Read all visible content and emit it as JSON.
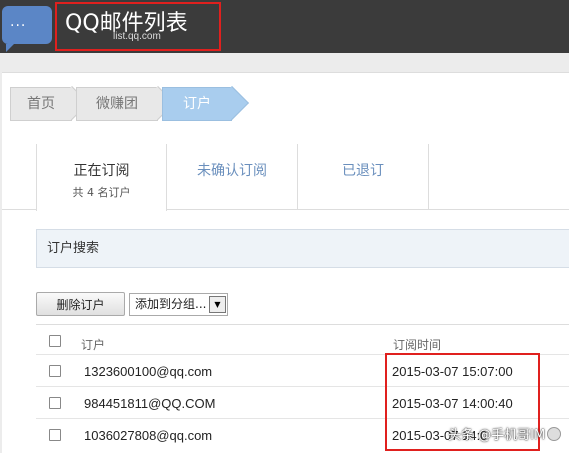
{
  "header": {
    "app_title": "QQ邮件列表",
    "subtitle": "list.qq.com",
    "logo_glyph": "···"
  },
  "breadcrumb": [
    {
      "label": "首页"
    },
    {
      "label": "微赚团"
    },
    {
      "label": "订户"
    }
  ],
  "tabs": [
    {
      "label": "正在订阅",
      "sub": "共 4 名订户",
      "active": true
    },
    {
      "label": "未确认订阅"
    },
    {
      "label": "已退订"
    }
  ],
  "search": {
    "label": "订户搜索"
  },
  "toolbar": {
    "delete_label": "删除订户",
    "group_select_value": "添加到分组..."
  },
  "table": {
    "columns": [
      "订户",
      "订阅时间"
    ],
    "rows": [
      {
        "email": "1323600100@qq.com",
        "time": "2015-03-07 15:07:00"
      },
      {
        "email": "984451811@QQ.COM",
        "time": "2015-03-07 14:00:40"
      },
      {
        "email": "1036027808@qq.com",
        "time": "2015-03-07 14:0"
      }
    ]
  },
  "watermark": {
    "text": "头条 @手机哥IM"
  },
  "colors": {
    "topbar": "#3b3b3b",
    "accent": "#a9cdee",
    "highlight": "#e0201e"
  }
}
